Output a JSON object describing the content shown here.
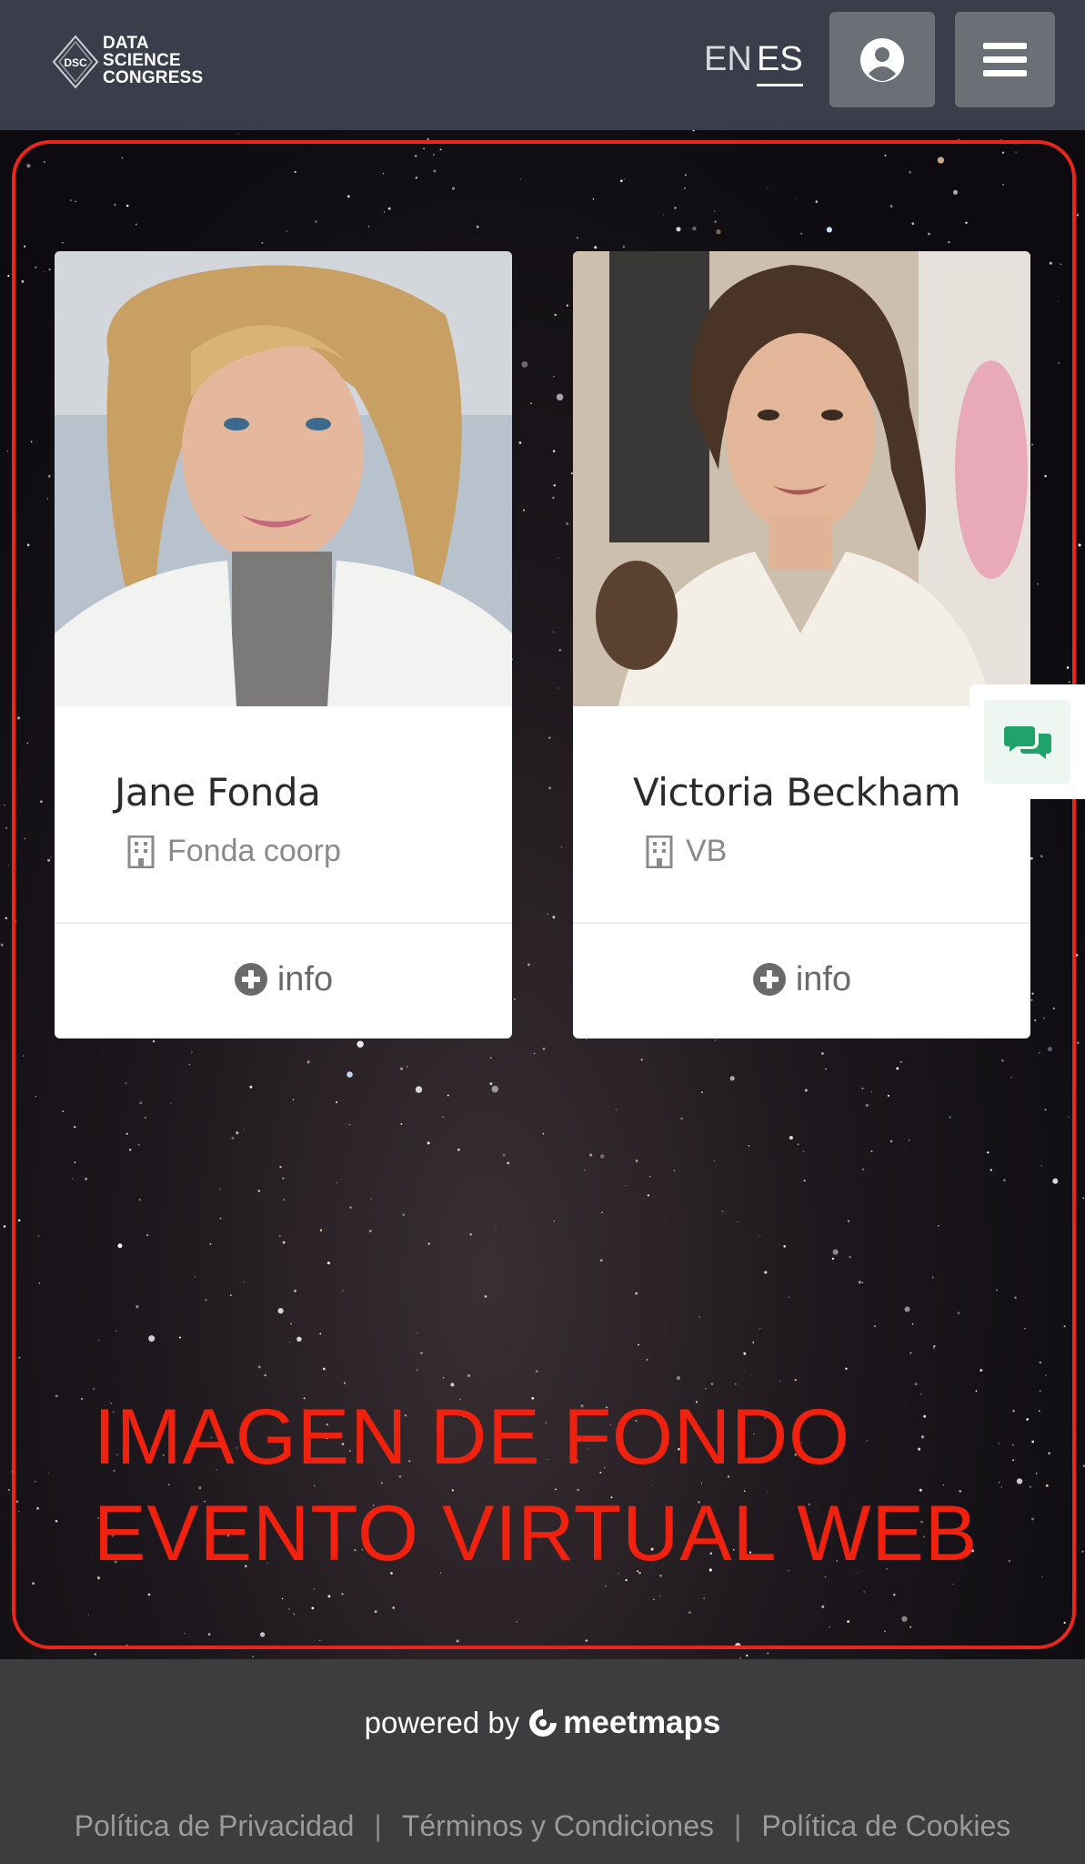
{
  "header": {
    "logo": {
      "badge": "DSC",
      "line1": "DATA",
      "line2": "SCIENCE",
      "line3": "CONGRESS"
    },
    "languages": [
      {
        "code": "EN",
        "active": false
      },
      {
        "code": "ES",
        "active": true
      }
    ],
    "user_icon": "user-circle-icon",
    "menu_icon": "hamburger-icon"
  },
  "speakers": [
    {
      "name": "Jane Fonda",
      "company": "Fonda coorp",
      "info_label": "info",
      "company_icon": "building-icon"
    },
    {
      "name": "Victoria Beckham",
      "company": "VB",
      "info_label": "info",
      "company_icon": "building-icon"
    }
  ],
  "chat": {
    "icon": "chat-bubbles-icon",
    "color": "#1fa36a"
  },
  "overlay": {
    "line1": "IMAGEN DE FONDO",
    "line2": "EVENTO VIRTUAL WEB",
    "color": "#f0220f"
  },
  "footer": {
    "powered_by": "powered by",
    "brand": "meetmaps",
    "links": [
      "Política de Privacidad",
      "Términos y Condiciones",
      "Política de Cookies"
    ],
    "separator": "|"
  }
}
